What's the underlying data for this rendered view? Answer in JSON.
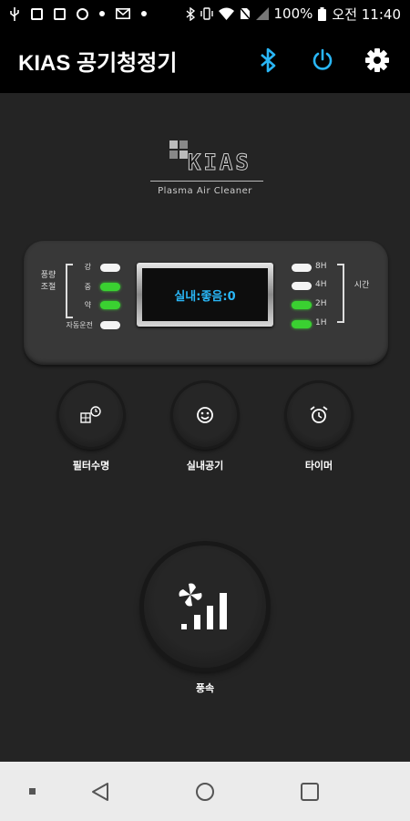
{
  "status_bar": {
    "left_icons": [
      "usb-icon",
      "sd-card-icon",
      "image-icon",
      "gmail-icon",
      "more-dots-icon"
    ],
    "right_icons": [
      "bluetooth-icon",
      "vibrate-icon",
      "wifi-icon",
      "no-sim-icon",
      "signal-icon",
      "battery-icon"
    ],
    "battery": "100%",
    "time": "오전 11:40"
  },
  "app_bar": {
    "title": "KIAS 공기청정기",
    "accent": "#29b6f6",
    "actions": [
      "bluetooth-icon",
      "power-icon",
      "gear-icon"
    ]
  },
  "logo": {
    "word": "KIAS",
    "tagline": "Plasma Air Cleaner"
  },
  "panel": {
    "airflow_label": "풍량\n조절",
    "airflow_levels": [
      {
        "label": "강",
        "on": false
      },
      {
        "label": "중",
        "on": true
      },
      {
        "label": "약",
        "on": true
      }
    ],
    "auto_label": "자동운전",
    "auto_on": false,
    "display_text": "실내:좋음:0",
    "time_label": "시간",
    "timer_levels": [
      {
        "label": "8H",
        "on": false
      },
      {
        "label": "4H",
        "on": false
      },
      {
        "label": "2H",
        "on": true
      },
      {
        "label": "1H",
        "on": true
      }
    ],
    "led_on_color": "#3ad131"
  },
  "buttons": {
    "filter": "필터수명",
    "indoor_air": "실내공기",
    "timer": "타이머",
    "fan": "풍속"
  },
  "nav": [
    "recent-dot-icon",
    "back-icon",
    "home-icon",
    "overview-icon"
  ]
}
